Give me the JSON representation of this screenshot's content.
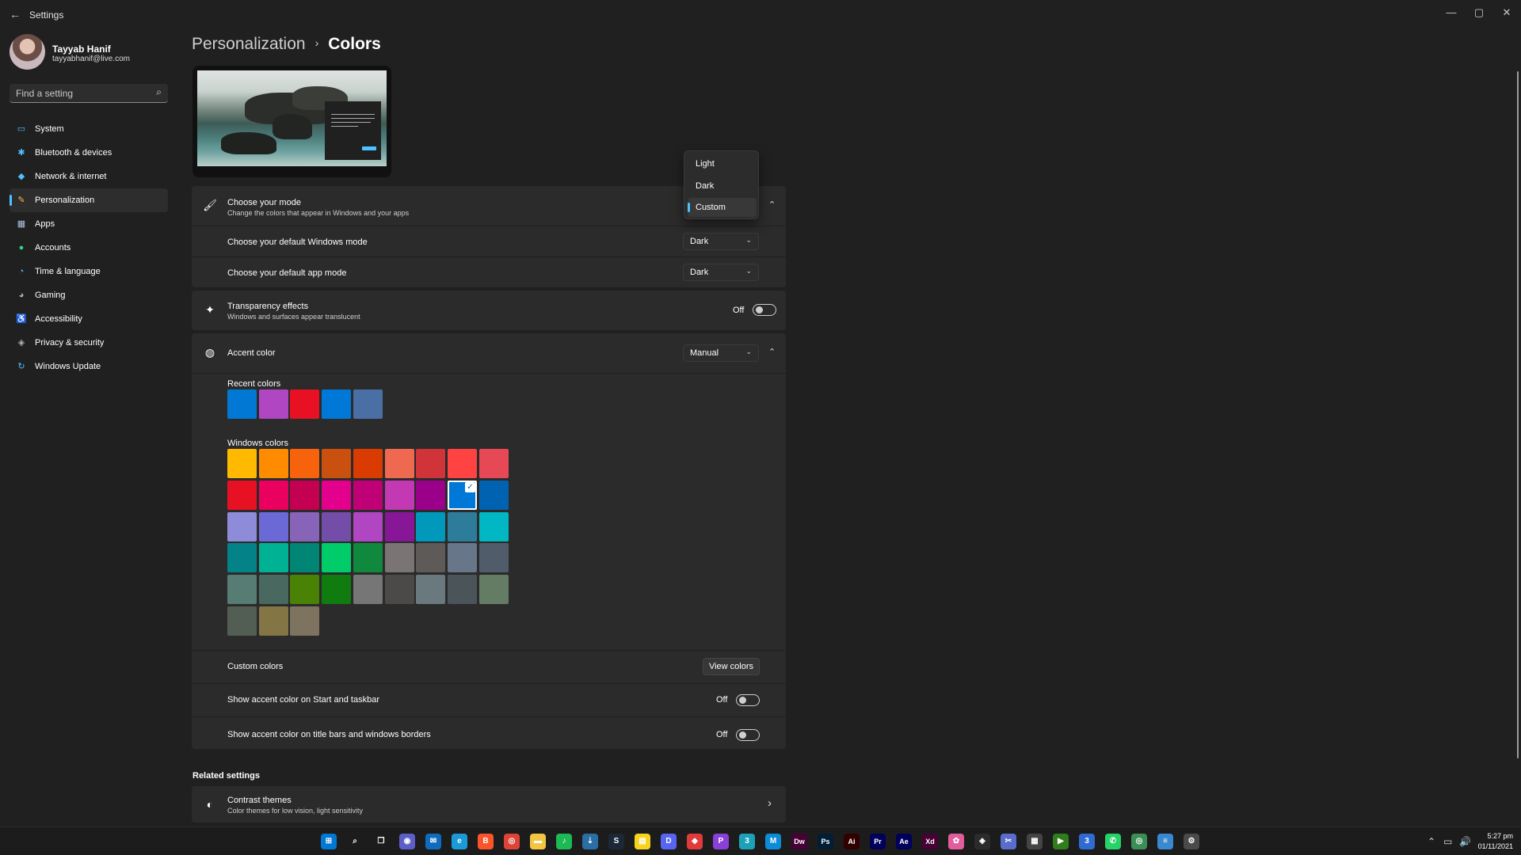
{
  "window": {
    "title": "Settings",
    "back_icon": "←",
    "minimize_icon": "—",
    "maximize_icon": "▢",
    "close_icon": "✕"
  },
  "profile": {
    "name": "Tayyab Hanif",
    "email": "tayyabhanif@live.com"
  },
  "search": {
    "placeholder": "Find a setting",
    "icon": "⌕"
  },
  "sidebar": {
    "items": [
      {
        "label": "System",
        "icon": "▭",
        "color": "#4cc2ff"
      },
      {
        "label": "Bluetooth & devices",
        "icon": "✱",
        "color": "#4cc2ff"
      },
      {
        "label": "Network & internet",
        "icon": "◆",
        "color": "#4cc2ff"
      },
      {
        "label": "Personalization",
        "icon": "✎",
        "color": "#ffb454"
      },
      {
        "label": "Apps",
        "icon": "▦",
        "color": "#b0c4de"
      },
      {
        "label": "Accounts",
        "icon": "●",
        "color": "#2fd487"
      },
      {
        "label": "Time & language",
        "icon": "◔",
        "color": "#4cc2ff"
      },
      {
        "label": "Gaming",
        "icon": "◕",
        "color": "#b0b0b0"
      },
      {
        "label": "Accessibility",
        "icon": "♿",
        "color": "#4cc2ff"
      },
      {
        "label": "Privacy & security",
        "icon": "◈",
        "color": "#b0b0b0"
      },
      {
        "label": "Windows Update",
        "icon": "↻",
        "color": "#4cc2ff"
      }
    ],
    "active_index": 3
  },
  "breadcrumb": {
    "parent": "Personalization",
    "separator": "›",
    "current": "Colors"
  },
  "mode": {
    "title": "Choose your mode",
    "subtitle": "Change the colors that appear in Windows and your apps",
    "icon": "🖌",
    "options": [
      "Light",
      "Dark",
      "Custom"
    ],
    "selected": "Custom",
    "collapse_icon": "⌃",
    "windows_mode": {
      "label": "Choose your default Windows mode",
      "value": "Dark"
    },
    "app_mode": {
      "label": "Choose your default app mode",
      "value": "Dark"
    }
  },
  "transparency": {
    "title": "Transparency effects",
    "subtitle": "Windows and surfaces appear translucent",
    "icon": "✦",
    "state": "Off"
  },
  "accent": {
    "title": "Accent color",
    "icon": "◍",
    "mode_value": "Manual",
    "collapse_icon": "⌃",
    "recent_label": "Recent colors",
    "recent_colors": [
      "#0078d4",
      "#b146c2",
      "#e81123",
      "#0078d7",
      "#4a6fa5"
    ],
    "windows_label": "Windows colors",
    "windows_colors": [
      [
        "#ffb900",
        "#ff8c00",
        "#f7630c",
        "#ca5010",
        "#da3b01",
        "#ef6950",
        "#d13438",
        "#ff4343",
        "#e74856"
      ],
      [
        "#e81123",
        "#ea005e",
        "#c30052",
        "#e3008c",
        "#bf0077",
        "#c239b3",
        "#9a0089",
        "#0078d7",
        "#0063b1"
      ],
      [
        "#8e8cd8",
        "#6b69d6",
        "#8764b8",
        "#744da9",
        "#b146c2",
        "#881798",
        "#0099bc",
        "#2d7d9a",
        "#00b7c3"
      ],
      [
        "#038387",
        "#00b294",
        "#018574",
        "#00cc6a",
        "#10893e",
        "#7a7574",
        "#5d5a58",
        "#68768a",
        "#515c6b"
      ],
      [
        "#567c73",
        "#486860",
        "#498205",
        "#107c10",
        "#767676",
        "#4c4a48",
        "#69797e",
        "#4a5459",
        "#647c64"
      ],
      [
        "#525e54",
        "#847545",
        "#7e735f"
      ]
    ],
    "selected_color": "#0078d7",
    "check_icon": "✓",
    "custom_label": "Custom colors",
    "view_colors_label": "View colors",
    "start_taskbar": {
      "label": "Show accent color on Start and taskbar",
      "state": "Off"
    },
    "title_bars": {
      "label": "Show accent color on title bars and windows borders",
      "state": "Off"
    }
  },
  "related": {
    "heading": "Related settings",
    "contrast": {
      "title": "Contrast themes",
      "subtitle": "Color themes for low vision, light sensitivity",
      "icon": "◐",
      "chevron": "›"
    }
  },
  "taskbar": {
    "apps": [
      {
        "name": "start",
        "glyph": "⊞",
        "bg": "#0078d4"
      },
      {
        "name": "search",
        "glyph": "⌕",
        "bg": "transparent"
      },
      {
        "name": "task-view",
        "glyph": "❐",
        "bg": "transparent"
      },
      {
        "name": "teams-chat",
        "glyph": "◉",
        "bg": "#5b5fc7"
      },
      {
        "name": "mail",
        "glyph": "✉",
        "bg": "#0f6cbd"
      },
      {
        "name": "edge",
        "glyph": "e",
        "bg": "#1a9bd7"
      },
      {
        "name": "brave",
        "glyph": "B",
        "bg": "#fb542b"
      },
      {
        "name": "chrome",
        "glyph": "◎",
        "bg": "#db4437"
      },
      {
        "name": "file-explorer",
        "glyph": "▬",
        "bg": "#f4c542"
      },
      {
        "name": "spotify",
        "glyph": "♪",
        "bg": "#1db954"
      },
      {
        "name": "steam-like",
        "glyph": "⇣",
        "bg": "#2b6ea3"
      },
      {
        "name": "steam",
        "glyph": "S",
        "bg": "#1b2838"
      },
      {
        "name": "sticky-notes",
        "glyph": "▤",
        "bg": "#f7d31e"
      },
      {
        "name": "discord",
        "glyph": "D",
        "bg": "#5865f2"
      },
      {
        "name": "app-red",
        "glyph": "◆",
        "bg": "#e03a3a"
      },
      {
        "name": "podcast-app",
        "glyph": "P",
        "bg": "#8b3fd9"
      },
      {
        "name": "app-3",
        "glyph": "3",
        "bg": "#1ca2b8"
      },
      {
        "name": "app-m",
        "glyph": "M",
        "bg": "#0c8bd9"
      },
      {
        "name": "dreamweaver",
        "glyph": "Dw",
        "bg": "#470137"
      },
      {
        "name": "photoshop",
        "glyph": "Ps",
        "bg": "#001e36"
      },
      {
        "name": "illustrator",
        "glyph": "Ai",
        "bg": "#330000"
      },
      {
        "name": "premiere",
        "glyph": "Pr",
        "bg": "#00005b"
      },
      {
        "name": "after-effects",
        "glyph": "Ae",
        "bg": "#00005b"
      },
      {
        "name": "xd",
        "glyph": "Xd",
        "bg": "#470137"
      },
      {
        "name": "photos",
        "glyph": "✿",
        "bg": "#e25d9d"
      },
      {
        "name": "davinci",
        "glyph": "◈",
        "bg": "#2b2b2b"
      },
      {
        "name": "snipping",
        "glyph": "✂",
        "bg": "#5b6dcc"
      },
      {
        "name": "calculator",
        "glyph": "▦",
        "bg": "#444"
      },
      {
        "name": "nvidia",
        "glyph": "▶",
        "bg": "#2f7d1c"
      },
      {
        "name": "notification-app",
        "glyph": "3",
        "bg": "#2f6bd3"
      },
      {
        "name": "whatsapp",
        "glyph": "✆",
        "bg": "#25d366"
      },
      {
        "name": "chrome-profile",
        "glyph": "◎",
        "bg": "#3b8f55"
      },
      {
        "name": "notepad",
        "glyph": "≡",
        "bg": "#3a88cf"
      },
      {
        "name": "settings",
        "glyph": "⚙",
        "bg": "#4a4a4a"
      }
    ],
    "tray_icons": [
      "⌃",
      "▭",
      "🔊"
    ],
    "time": "5:27 pm",
    "date": "01/11/2021"
  }
}
